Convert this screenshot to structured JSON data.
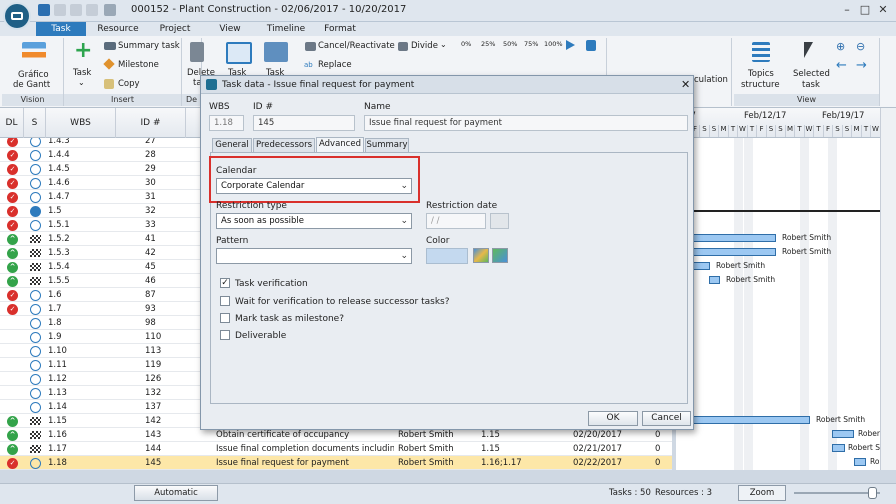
{
  "window": {
    "title": "000152 - Plant Construction - 02/06/2017 - 10/20/2017"
  },
  "tabs": [
    "Task",
    "Resource",
    "Project",
    "View",
    "Timeline",
    "Format"
  ],
  "ribbon": {
    "gantt_label_1": "Gráfico",
    "gantt_label_2": "de Gantt",
    "vision_group": "Vision",
    "task_btn": "Task",
    "summary_task": "Summary task",
    "milestone": "Milestone",
    "copy": "Copy",
    "insert_group": "Insert",
    "delete_1": "Delete",
    "delete_2": "ta",
    "delete_group": "De",
    "task_a": "Task",
    "task_b": "Task",
    "cancel_reactivate": "Cancel/Reactivate",
    "divide": "Divide",
    "replace": "Replace",
    "pct": [
      "0%",
      "25%",
      "50%",
      "75%",
      "100%"
    ],
    "calculation": "culation",
    "topics_1": "Topics",
    "topics_2": "structure",
    "selected_1": "Selected",
    "selected_2": "task",
    "view_group": "View"
  },
  "grid": {
    "headers": [
      "DL",
      "S",
      "WBS",
      "ID #"
    ],
    "rows": [
      {
        "dl": "r",
        "st": "clock",
        "wbs": "1.4.3",
        "id": "27",
        "name": "",
        "resource": "",
        "pred": "",
        "date": "",
        "dur": ""
      },
      {
        "dl": "r",
        "st": "clock",
        "wbs": "1.4.4",
        "id": "28",
        "name": "",
        "resource": "",
        "pred": "",
        "date": "",
        "dur": ""
      },
      {
        "dl": "r",
        "st": "clock",
        "wbs": "1.4.5",
        "id": "29",
        "name": "",
        "resource": "",
        "pred": "",
        "date": "",
        "dur": ""
      },
      {
        "dl": "r",
        "st": "clock",
        "wbs": "1.4.6",
        "id": "30",
        "name": "",
        "resource": "",
        "pred": "",
        "date": "",
        "dur": ""
      },
      {
        "dl": "r",
        "st": "clock",
        "wbs": "1.4.7",
        "id": "31",
        "name": "",
        "resource": "",
        "pred": "",
        "date": "",
        "dur": ""
      },
      {
        "dl": "r",
        "st": "play",
        "wbs": "1.5",
        "id": "32",
        "name": "",
        "resource": "",
        "pred": "",
        "date": "",
        "dur": ""
      },
      {
        "dl": "r",
        "st": "clock",
        "wbs": "1.5.1",
        "id": "33",
        "name": "",
        "resource": "",
        "pred": "",
        "date": "",
        "dur": ""
      },
      {
        "dl": "g",
        "st": "flag",
        "wbs": "1.5.2",
        "id": "41",
        "name": "",
        "resource": "",
        "pred": "",
        "date": "",
        "dur": ""
      },
      {
        "dl": "g",
        "st": "flag",
        "wbs": "1.5.3",
        "id": "42",
        "name": "",
        "resource": "",
        "pred": "",
        "date": "",
        "dur": ""
      },
      {
        "dl": "g",
        "st": "flag",
        "wbs": "1.5.4",
        "id": "45",
        "name": "",
        "resource": "",
        "pred": "",
        "date": "",
        "dur": ""
      },
      {
        "dl": "g",
        "st": "flag",
        "wbs": "1.5.5",
        "id": "46",
        "name": "",
        "resource": "",
        "pred": "",
        "date": "",
        "dur": ""
      },
      {
        "dl": "r",
        "st": "clock",
        "wbs": "1.6",
        "id": "87",
        "name": "",
        "resource": "",
        "pred": "",
        "date": "",
        "dur": ""
      },
      {
        "dl": "r",
        "st": "clock",
        "wbs": "1.7",
        "id": "93",
        "name": "",
        "resource": "",
        "pred": "",
        "date": "",
        "dur": ""
      },
      {
        "dl": "",
        "st": "clock",
        "wbs": "1.8",
        "id": "98",
        "name": "",
        "resource": "",
        "pred": "",
        "date": "",
        "dur": ""
      },
      {
        "dl": "",
        "st": "clock",
        "wbs": "1.9",
        "id": "110",
        "name": "",
        "resource": "",
        "pred": "",
        "date": "",
        "dur": ""
      },
      {
        "dl": "",
        "st": "clock",
        "wbs": "1.10",
        "id": "113",
        "name": "",
        "resource": "",
        "pred": "",
        "date": "",
        "dur": ""
      },
      {
        "dl": "",
        "st": "clock",
        "wbs": "1.11",
        "id": "119",
        "name": "",
        "resource": "",
        "pred": "",
        "date": "",
        "dur": ""
      },
      {
        "dl": "",
        "st": "clock",
        "wbs": "1.12",
        "id": "126",
        "name": "",
        "resource": "",
        "pred": "",
        "date": "",
        "dur": ""
      },
      {
        "dl": "",
        "st": "clock",
        "wbs": "1.13",
        "id": "132",
        "name": "",
        "resource": "",
        "pred": "",
        "date": "",
        "dur": ""
      },
      {
        "dl": "",
        "st": "clock",
        "wbs": "1.14",
        "id": "137",
        "name": "",
        "resource": "",
        "pred": "",
        "date": "",
        "dur": ""
      },
      {
        "dl": "g",
        "st": "flag",
        "wbs": "1.15",
        "id": "142",
        "name": "",
        "resource": "",
        "pred": "",
        "date": "",
        "dur": ""
      },
      {
        "dl": "g",
        "st": "flag",
        "wbs": "1.16",
        "id": "143",
        "name": "Obtain certificate of occupancy",
        "resource": "Robert Smith",
        "pred": "1.15",
        "date": "02/20/2017",
        "dur": "0"
      },
      {
        "dl": "g",
        "st": "flag",
        "wbs": "1.17",
        "id": "144",
        "name": "Issue final completion documents including wa",
        "resource": "Robert Smith",
        "pred": "1.15",
        "date": "02/21/2017",
        "dur": "0"
      },
      {
        "dl": "r",
        "st": "clock",
        "wbs": "1.18",
        "id": "145",
        "name": "Issue final request for payment",
        "resource": "Robert Smith",
        "pred": "1.16;1.17",
        "date": "02/22/2017",
        "dur": "0"
      }
    ]
  },
  "gantt": {
    "weeks": [
      "/5/17",
      "Feb/12/17",
      "Feb/19/17"
    ],
    "days": [
      "W",
      "T",
      "F",
      "S",
      "S",
      "M",
      "T",
      "W",
      "T",
      "F",
      "S",
      "S",
      "M",
      "T",
      "W",
      "T",
      "F",
      "S",
      "S",
      "M",
      "T",
      "W",
      "T"
    ],
    "labels": [
      "Robert Smith",
      "Robert Smith",
      "Robert Smith",
      "Robert Smith",
      "Robert Smith",
      "Robert Sm",
      "Robert Sr",
      "Robert S"
    ]
  },
  "statusbar": {
    "mode": "Automatic",
    "tasks": "Tasks : 50",
    "resources": "Resources : 3",
    "zoom": "Zoom"
  },
  "dialog": {
    "title": "Task data - Issue final request for payment",
    "wbs_label": "WBS",
    "wbs_value": "1.18",
    "id_label": "ID #",
    "id_value": "145",
    "name_label": "Name",
    "name_value": "Issue final request for payment",
    "tabs": [
      "General",
      "Predecessors",
      "Advanced",
      "Summary"
    ],
    "calendar_label": "Calendar",
    "calendar_value": "Corporate Calendar",
    "restriction_type_label": "Restriction type",
    "restriction_type_value": "As soon as possible",
    "restriction_date_label": "Restriction date",
    "restriction_date_value": "/ /",
    "pattern_label": "Pattern",
    "pattern_value": "",
    "color_label": "Color",
    "task_verification": "Task verification",
    "wait_verification": "Wait for verification to release successor tasks?",
    "mark_milestone": "Mark task as milestone?",
    "deliverable": "Deliverable",
    "ok": "OK",
    "cancel": "Cancel",
    "accent": "#d9302c"
  }
}
